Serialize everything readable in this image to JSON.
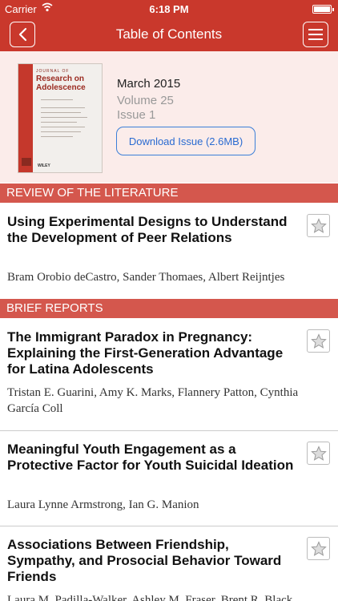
{
  "status_bar": {
    "carrier": "Carrier",
    "time": "6:18 PM"
  },
  "nav": {
    "title": "Table of Contents"
  },
  "issue": {
    "cover": {
      "label": "JOURNAL OF",
      "title": "Research on Adolescence",
      "publisher": "WILEY"
    },
    "month": "March 2015",
    "volume": "Volume 25",
    "issue": "Issue 1",
    "download_label": "Download Issue (2.6MB)"
  },
  "sections": [
    {
      "label": "REVIEW OF THE LITERATURE",
      "articles": [
        {
          "title": "Using Experimental Designs to Understand the Development of Peer Relations",
          "authors": "Bram Orobio deCastro, Sander Thomaes, Albert Reijntjes"
        }
      ]
    },
    {
      "label": "BRIEF REPORTS",
      "articles": [
        {
          "title": "The Immigrant Paradox in Pregnancy: Explaining the First-Generation Advantage for Latina Adolescents",
          "authors": "Tristan E. Guarini, Amy K. Marks, Flannery Patton, Cynthia García Coll"
        },
        {
          "title": "Meaningful Youth Engagement as a Protective Factor for Youth Suicidal Ideation",
          "authors": "Laura Lynne Armstrong, Ian G. Manion"
        },
        {
          "title": "Associations Between Friendship, Sympathy, and Prosocial Behavior Toward Friends",
          "authors": "Laura M. Padilla-Walker, Ashley M. Fraser, Brent R. Black"
        }
      ]
    }
  ],
  "colors": {
    "nav_bg": "#c9382c",
    "section_bg": "#d4574d",
    "issue_bg": "#fbecea",
    "link": "#2a6bd1"
  }
}
